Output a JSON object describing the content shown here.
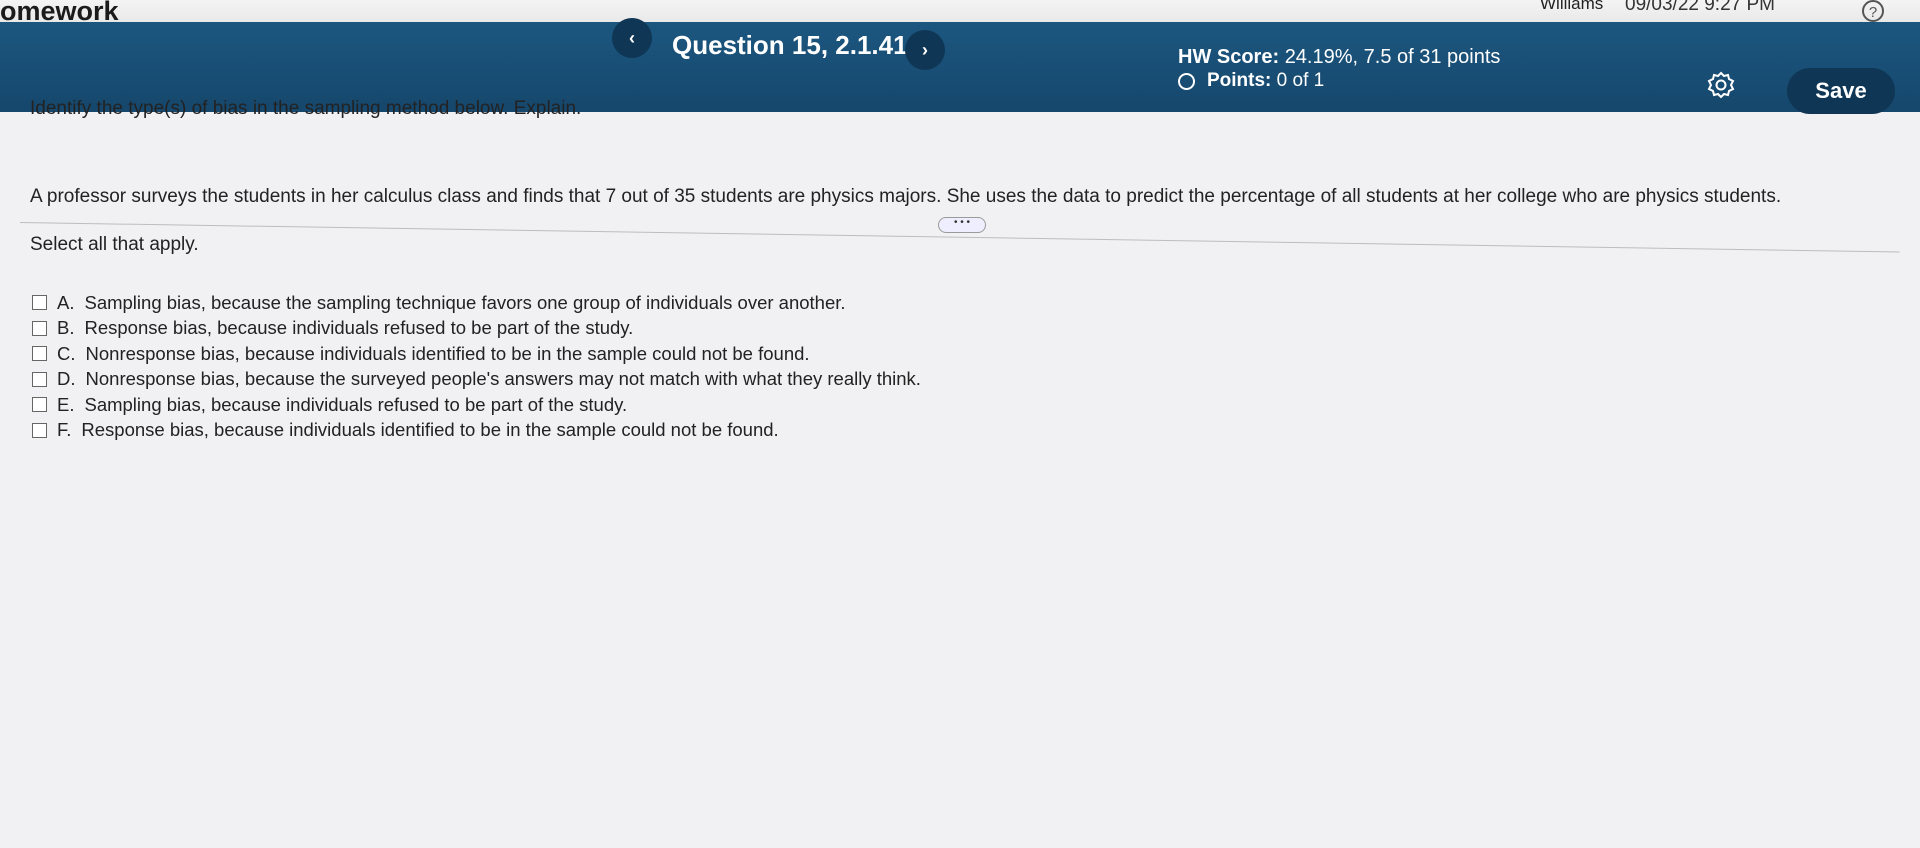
{
  "header": {
    "app_title": "omework",
    "user_name": "Williams",
    "datetime": "09/03/22 9:27 PM",
    "help": "?",
    "prev_icon": "‹",
    "next_icon": "›",
    "question": "Question 15, 2.1.41",
    "hw_score_label": "HW Score:",
    "hw_score_value": "24.19%, 7.5 of 31 points",
    "points_label": "Points:",
    "points_value": "0 of 1",
    "save": "Save"
  },
  "content": {
    "instruction": "Identify the type(s) of bias in the sampling method below. Explain.",
    "problem": "A professor surveys the students in her calculus class and finds that 7 out of 35 students are physics majors. She uses the data to predict the percentage of all students at her college who are physics students.",
    "more": "• • •",
    "select_all": "Select all that apply."
  },
  "options": [
    {
      "letter": "A.",
      "text": "Sampling bias, because the sampling technique favors one group of individuals over another."
    },
    {
      "letter": "B.",
      "text": "Response bias, because individuals refused to be part of the study."
    },
    {
      "letter": "C.",
      "text": "Nonresponse bias, because individuals identified to be in the sample could not be found."
    },
    {
      "letter": "D.",
      "text": "Nonresponse bias, because the surveyed people's answers may not match with what they really think."
    },
    {
      "letter": "E.",
      "text": "Sampling bias, because individuals refused to be part of the study."
    },
    {
      "letter": "F.",
      "text": "Response bias, because individuals identified to be in the sample could not be found."
    }
  ],
  "colors": {
    "header_bg": "#16476c",
    "button_bg": "#0f3654",
    "page_bg": "#f1f1f3"
  }
}
